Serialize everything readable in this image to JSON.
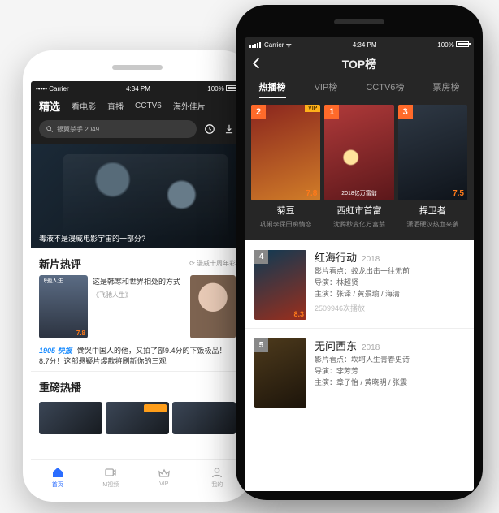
{
  "status": {
    "carrier_long": "••••• Carrier",
    "carrier_short_wifi": "Carrier ᯤ",
    "time": "4:34 PM",
    "battery": "100%"
  },
  "left": {
    "topnav": {
      "active": "精选",
      "items": [
        "看电影",
        "直播",
        "CCTV6",
        "海外佳片"
      ]
    },
    "search_placeholder": "银翼杀手 2049",
    "hero_caption": "毒液不是漫威电影宇宙的一部分?",
    "section_new": {
      "title": "新片热评",
      "more": "⟳ 漫威十周年彩",
      "poster1_label": "飞驰人生",
      "poster1_rating": "7.8",
      "blurb_title": "这是韩寒和世界相处的方式",
      "blurb_sub": "《飞驰人生》",
      "news_brand": "1905 快报",
      "news_text": "馋哭中国人的他，又拍了部9.4分的下饭极品！ 8.7分！这部悬疑片爆款将刷新你的三观"
    },
    "section_hot": {
      "title": "重磅热播"
    },
    "tabs": {
      "home": "首页",
      "mvideo": "M视频",
      "vip": "VIP",
      "mine": "我的"
    }
  },
  "right": {
    "nav_title": "TOP榜",
    "subtabs": {
      "active": "热播榜",
      "items": [
        "VIP榜",
        "CCTV6榜",
        "票房榜"
      ]
    },
    "top3": [
      {
        "rank": "2",
        "vip": "VIP",
        "rating": "7.8",
        "name": "菊豆",
        "sub": "巩俐李保田痴情恋"
      },
      {
        "rank": "1",
        "vip": "",
        "rating": "",
        "name": "西虹市首富",
        "sub": "沈腾秒变亿万富翁",
        "tagline": "2018亿万富翁"
      },
      {
        "rank": "3",
        "vip": "",
        "rating": "7.5",
        "name": "捍卫者",
        "sub": "潇洒硬汉热血来袭"
      }
    ],
    "list": [
      {
        "rank": "4",
        "rating": "8.3",
        "title": "红海行动",
        "year": "2018",
        "tagline": "影片看点：蛟龙出击一往无前",
        "director_label": "导演：",
        "director": "林超贤",
        "cast_label": "主演：",
        "cast": "张译 / 黄景瑜 / 海清",
        "plays": "2509946次播放"
      },
      {
        "rank": "5",
        "rating": "",
        "title": "无问西东",
        "year": "2018",
        "tagline": "影片看点：坎坷人生青春史诗",
        "director_label": "导演：",
        "director": "李芳芳",
        "cast_label": "主演：",
        "cast": "章子怡 / 黄晓明 / 张震",
        "plays": ""
      }
    ]
  }
}
